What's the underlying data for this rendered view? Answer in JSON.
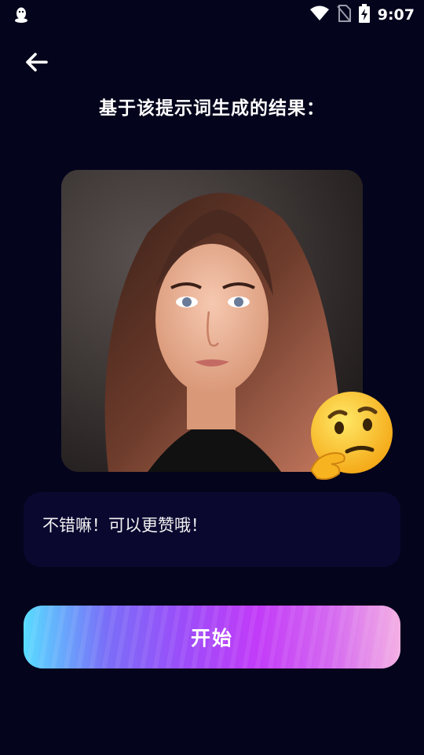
{
  "status_bar": {
    "time": "9:07",
    "icons": [
      "qq-icon",
      "wifi-icon",
      "no-sim-icon",
      "battery-charging-icon"
    ]
  },
  "header": {
    "back_icon": "arrow-left-icon",
    "title": "基于该提示词生成的结果："
  },
  "result": {
    "image_icon": "portrait-image",
    "reaction_emoji": "thinking-face-emoji"
  },
  "comment": {
    "text": "不错嘛！可以更赞哦！"
  },
  "actions": {
    "start_label": "开始"
  },
  "colors": {
    "background": "#04041c",
    "comment_bg": "#0b0830",
    "gradient_start": "#58dcff",
    "gradient_mid": "#c23bf8",
    "gradient_end": "#f4b0e4"
  }
}
